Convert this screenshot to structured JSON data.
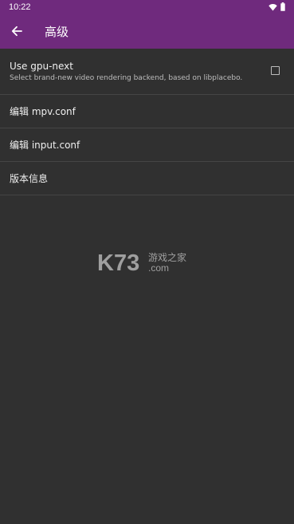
{
  "status_bar": {
    "time": "10:22",
    "icons": [
      "wifi-icon",
      "battery-icon"
    ]
  },
  "app_bar": {
    "back_icon": "arrow-left-icon",
    "title": "高级"
  },
  "preferences": [
    {
      "title": "Use gpu-next",
      "summary": "Select brand-new video rendering backend, based on libplacebo.",
      "checked": false
    },
    {
      "title": "编辑 mpv.conf"
    },
    {
      "title": "编辑 input.conf"
    },
    {
      "title": "版本信息"
    }
  ],
  "watermark": {
    "brand": "K73",
    "tagline": "游戏之家",
    "domain": ".com"
  },
  "colors": {
    "primary": "#6f2a7d",
    "background": "#303030",
    "divider": "#454545"
  }
}
